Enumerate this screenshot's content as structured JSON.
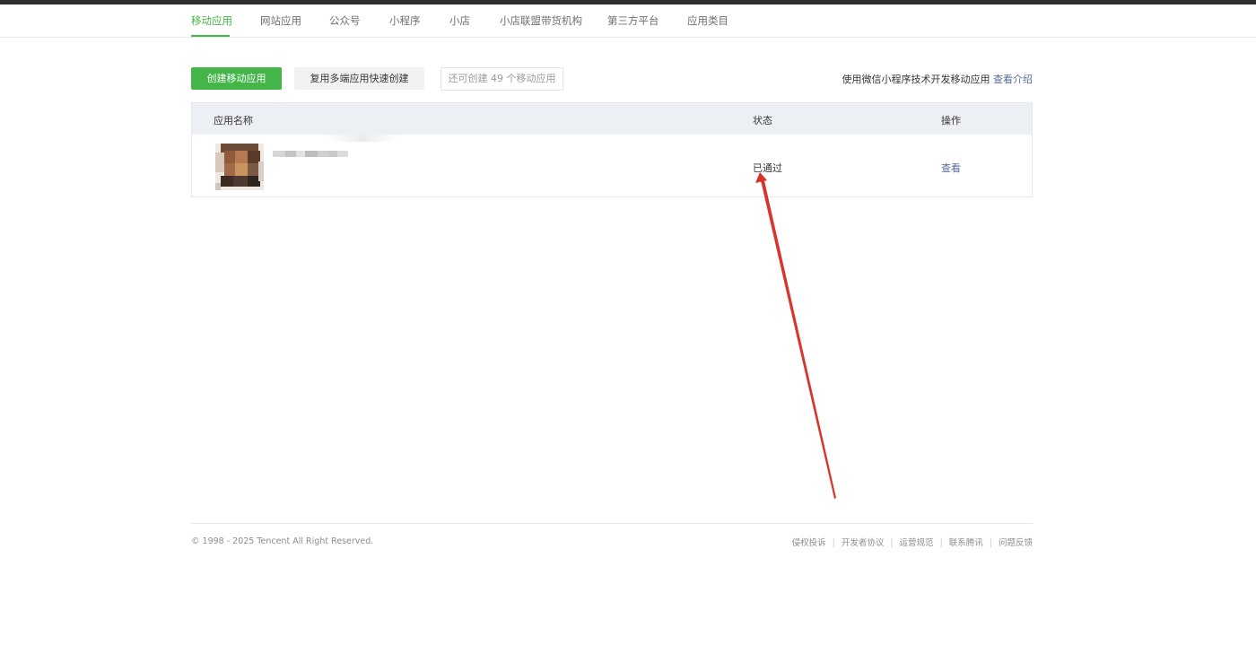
{
  "nav": {
    "tabs": [
      {
        "label": "移动应用",
        "active": true
      },
      {
        "label": "网站应用",
        "active": false
      },
      {
        "label": "公众号",
        "active": false
      },
      {
        "label": "小程序",
        "active": false
      },
      {
        "label": "小店",
        "active": false
      },
      {
        "label": "小店联盟带货机构",
        "active": false
      },
      {
        "label": "第三方平台",
        "active": false
      },
      {
        "label": "应用类目",
        "active": false
      }
    ]
  },
  "toolbar": {
    "create_label": "创建移动应用",
    "reuse_label": "复用多端应用快速创建",
    "remaining_label": "还可创建 49 个移动应用",
    "intro_text": "使用微信小程序技术开发移动应用",
    "intro_link": "查看介绍"
  },
  "table": {
    "headers": {
      "name": "应用名称",
      "status": "状态",
      "action": "操作"
    },
    "rows": [
      {
        "status": "已通过",
        "action": "查看"
      }
    ]
  },
  "footer": {
    "copyright": "© 1998 - 2025 Tencent All Right Reserved.",
    "links": [
      "侵权投诉",
      "开发者协议",
      "运营规范",
      "联系腾讯",
      "问题反馈"
    ]
  },
  "colors": {
    "accent": "#44b549",
    "link": "#576b95",
    "annotation_arrow": "#d9342b"
  }
}
